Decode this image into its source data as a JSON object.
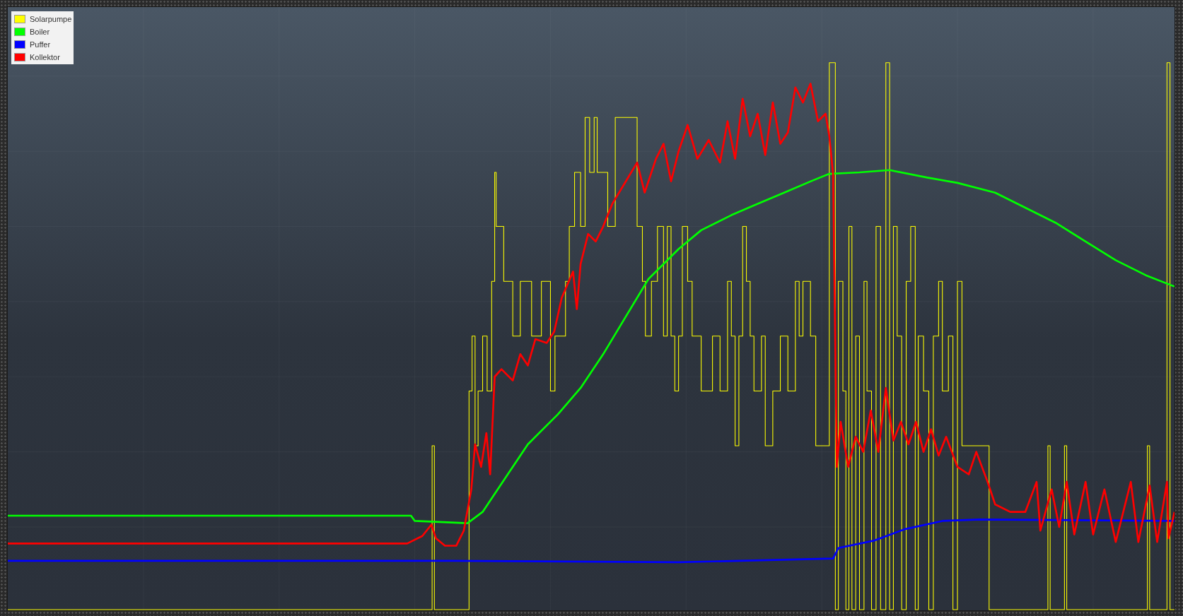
{
  "legend": {
    "items": [
      {
        "label": "Solarpumpe",
        "color": "#ffff00"
      },
      {
        "label": "Boiler",
        "color": "#00ff00"
      },
      {
        "label": "Puffer",
        "color": "#0000ff"
      },
      {
        "label": "Kollektor",
        "color": "#ff0000"
      }
    ]
  }
}
